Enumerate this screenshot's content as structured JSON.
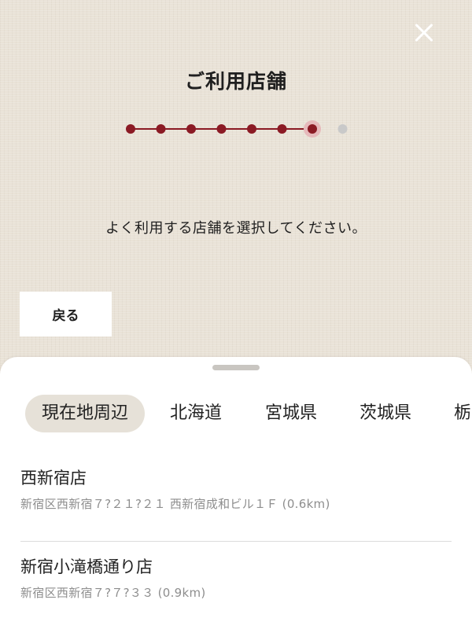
{
  "header": {
    "title": "ご利用店舗",
    "close_icon": "close-icon"
  },
  "stepper": {
    "total_steps": 8,
    "current_step": 7,
    "active_color": "#8b1a24",
    "inactive_color": "#c9c9c9"
  },
  "instruction": "よく利用する店舗を選択してください。",
  "back_button": {
    "label": "戻る"
  },
  "sheet": {
    "tabs": [
      {
        "label": "現在地周辺",
        "active": true
      },
      {
        "label": "北海道",
        "active": false
      },
      {
        "label": "宮城県",
        "active": false
      },
      {
        "label": "茨城県",
        "active": false
      },
      {
        "label": "栃",
        "active": false
      }
    ],
    "stores": [
      {
        "name": "西新宿店",
        "address": "新宿区西新宿７?２１?２１ 西新宿成和ビル１Ｆ (0.6km)"
      },
      {
        "name": "新宿小滝橋通り店",
        "address": "新宿区西新宿７?７?３３ (0.9km)"
      }
    ]
  }
}
